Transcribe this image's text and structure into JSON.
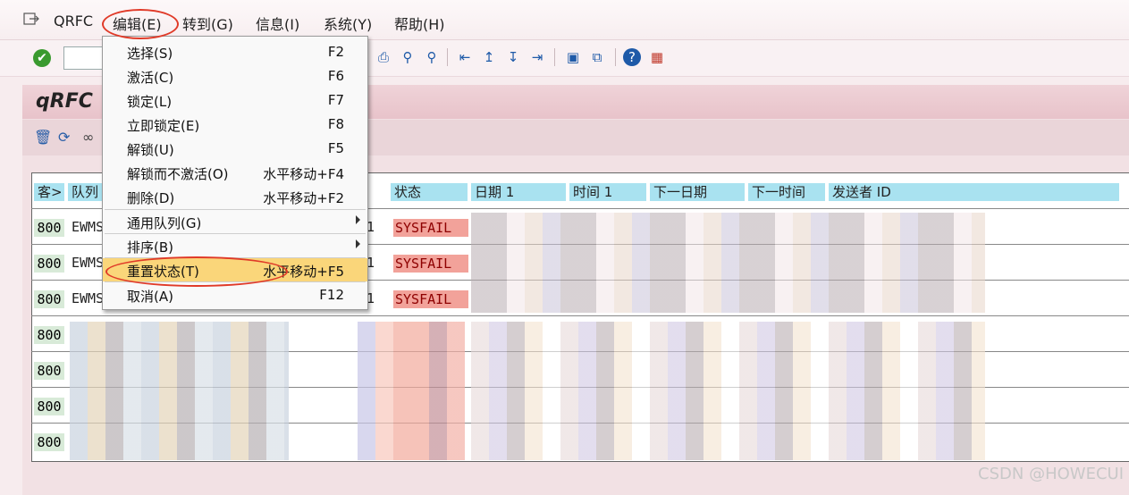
{
  "menubar": {
    "items": [
      "QRFC",
      "编辑(E)",
      "转到(G)",
      "信息(I)",
      "系统(Y)",
      "帮助(H)"
    ]
  },
  "title": "qRFC",
  "columns": [
    "客>",
    "队列",
    "状态",
    "日期 1",
    "时间 1",
    "下一日期",
    "下一时间",
    "发送者 ID"
  ],
  "rows": [
    {
      "client": "800",
      "queue": "EWMS",
      "count": "1",
      "status": "SYSFAIL"
    },
    {
      "client": "800",
      "queue": "EWMS",
      "count": "1",
      "status": "SYSFAIL"
    },
    {
      "client": "800",
      "queue": "EWMS",
      "count": "1",
      "status": "SYSFAIL"
    },
    {
      "client": "800"
    },
    {
      "client": "800"
    },
    {
      "client": "800"
    },
    {
      "client": "800"
    }
  ],
  "menu": {
    "items": [
      {
        "label": "选择(S)",
        "shortcut": "F2"
      },
      {
        "label": "激活(C)",
        "shortcut": "F6"
      },
      {
        "label": "锁定(L)",
        "shortcut": "F7"
      },
      {
        "label": "立即锁定(E)",
        "shortcut": "F8"
      },
      {
        "label": "解锁(U)",
        "shortcut": "F5"
      },
      {
        "label": "解锁而不激活(O)",
        "shortcut": "水平移动+F4"
      },
      {
        "label": "删除(D)",
        "shortcut": "水平移动+F2"
      },
      {
        "label": "通用队列(G)",
        "shortcut": ""
      },
      {
        "label": "排序(B)",
        "shortcut": ""
      },
      {
        "label": "重置状态(T)",
        "shortcut": "水平移动+F5"
      },
      {
        "label": "取消(A)",
        "shortcut": "F12"
      }
    ]
  },
  "watermark": "CSDN @HOWECUI",
  "colors": {
    "highlight": "#fad67a",
    "annotation": "#e03a28",
    "status_bg": "#f2a29a",
    "header_bg": "#a9e2f0"
  },
  "icons": [
    "exit-icon",
    "check-icon",
    "print-icon",
    "find-icon",
    "find-next-icon",
    "first-page-icon",
    "previous-page-icon",
    "next-page-icon",
    "last-page-icon",
    "create-session-icon",
    "shortcut-icon",
    "help-icon",
    "layout-icon",
    "delete-icon",
    "refresh-icon",
    "glasses-icon"
  ]
}
